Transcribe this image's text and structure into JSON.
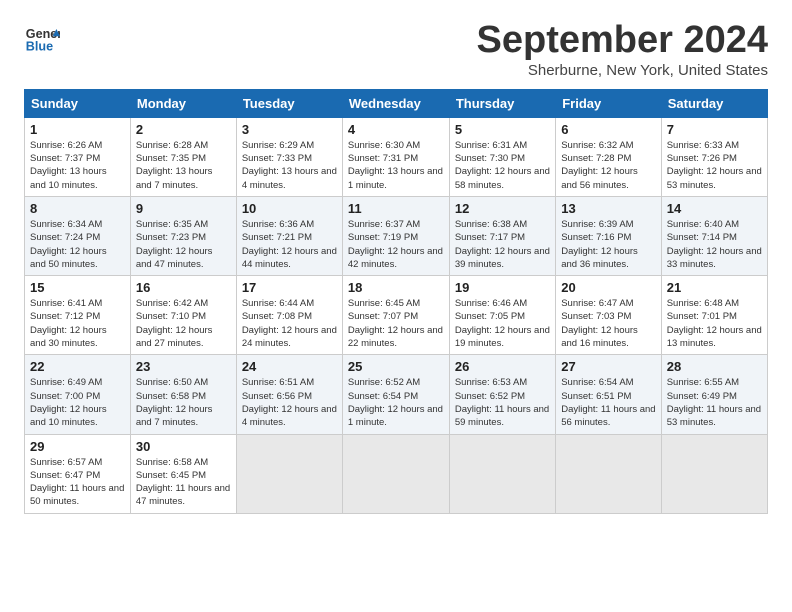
{
  "header": {
    "logo_line1": "General",
    "logo_line2": "Blue",
    "month": "September 2024",
    "location": "Sherburne, New York, United States"
  },
  "weekdays": [
    "Sunday",
    "Monday",
    "Tuesday",
    "Wednesday",
    "Thursday",
    "Friday",
    "Saturday"
  ],
  "weeks": [
    [
      {
        "day": "1",
        "sunrise": "6:26 AM",
        "sunset": "7:37 PM",
        "daylight": "13 hours and 10 minutes."
      },
      {
        "day": "2",
        "sunrise": "6:28 AM",
        "sunset": "7:35 PM",
        "daylight": "13 hours and 7 minutes."
      },
      {
        "day": "3",
        "sunrise": "6:29 AM",
        "sunset": "7:33 PM",
        "daylight": "13 hours and 4 minutes."
      },
      {
        "day": "4",
        "sunrise": "6:30 AM",
        "sunset": "7:31 PM",
        "daylight": "13 hours and 1 minute."
      },
      {
        "day": "5",
        "sunrise": "6:31 AM",
        "sunset": "7:30 PM",
        "daylight": "12 hours and 58 minutes."
      },
      {
        "day": "6",
        "sunrise": "6:32 AM",
        "sunset": "7:28 PM",
        "daylight": "12 hours and 56 minutes."
      },
      {
        "day": "7",
        "sunrise": "6:33 AM",
        "sunset": "7:26 PM",
        "daylight": "12 hours and 53 minutes."
      }
    ],
    [
      {
        "day": "8",
        "sunrise": "6:34 AM",
        "sunset": "7:24 PM",
        "daylight": "12 hours and 50 minutes."
      },
      {
        "day": "9",
        "sunrise": "6:35 AM",
        "sunset": "7:23 PM",
        "daylight": "12 hours and 47 minutes."
      },
      {
        "day": "10",
        "sunrise": "6:36 AM",
        "sunset": "7:21 PM",
        "daylight": "12 hours and 44 minutes."
      },
      {
        "day": "11",
        "sunrise": "6:37 AM",
        "sunset": "7:19 PM",
        "daylight": "12 hours and 42 minutes."
      },
      {
        "day": "12",
        "sunrise": "6:38 AM",
        "sunset": "7:17 PM",
        "daylight": "12 hours and 39 minutes."
      },
      {
        "day": "13",
        "sunrise": "6:39 AM",
        "sunset": "7:16 PM",
        "daylight": "12 hours and 36 minutes."
      },
      {
        "day": "14",
        "sunrise": "6:40 AM",
        "sunset": "7:14 PM",
        "daylight": "12 hours and 33 minutes."
      }
    ],
    [
      {
        "day": "15",
        "sunrise": "6:41 AM",
        "sunset": "7:12 PM",
        "daylight": "12 hours and 30 minutes."
      },
      {
        "day": "16",
        "sunrise": "6:42 AM",
        "sunset": "7:10 PM",
        "daylight": "12 hours and 27 minutes."
      },
      {
        "day": "17",
        "sunrise": "6:44 AM",
        "sunset": "7:08 PM",
        "daylight": "12 hours and 24 minutes."
      },
      {
        "day": "18",
        "sunrise": "6:45 AM",
        "sunset": "7:07 PM",
        "daylight": "12 hours and 22 minutes."
      },
      {
        "day": "19",
        "sunrise": "6:46 AM",
        "sunset": "7:05 PM",
        "daylight": "12 hours and 19 minutes."
      },
      {
        "day": "20",
        "sunrise": "6:47 AM",
        "sunset": "7:03 PM",
        "daylight": "12 hours and 16 minutes."
      },
      {
        "day": "21",
        "sunrise": "6:48 AM",
        "sunset": "7:01 PM",
        "daylight": "12 hours and 13 minutes."
      }
    ],
    [
      {
        "day": "22",
        "sunrise": "6:49 AM",
        "sunset": "7:00 PM",
        "daylight": "12 hours and 10 minutes."
      },
      {
        "day": "23",
        "sunrise": "6:50 AM",
        "sunset": "6:58 PM",
        "daylight": "12 hours and 7 minutes."
      },
      {
        "day": "24",
        "sunrise": "6:51 AM",
        "sunset": "6:56 PM",
        "daylight": "12 hours and 4 minutes."
      },
      {
        "day": "25",
        "sunrise": "6:52 AM",
        "sunset": "6:54 PM",
        "daylight": "12 hours and 1 minute."
      },
      {
        "day": "26",
        "sunrise": "6:53 AM",
        "sunset": "6:52 PM",
        "daylight": "11 hours and 59 minutes."
      },
      {
        "day": "27",
        "sunrise": "6:54 AM",
        "sunset": "6:51 PM",
        "daylight": "11 hours and 56 minutes."
      },
      {
        "day": "28",
        "sunrise": "6:55 AM",
        "sunset": "6:49 PM",
        "daylight": "11 hours and 53 minutes."
      }
    ],
    [
      {
        "day": "29",
        "sunrise": "6:57 AM",
        "sunset": "6:47 PM",
        "daylight": "11 hours and 50 minutes."
      },
      {
        "day": "30",
        "sunrise": "6:58 AM",
        "sunset": "6:45 PM",
        "daylight": "11 hours and 47 minutes."
      },
      null,
      null,
      null,
      null,
      null
    ]
  ]
}
